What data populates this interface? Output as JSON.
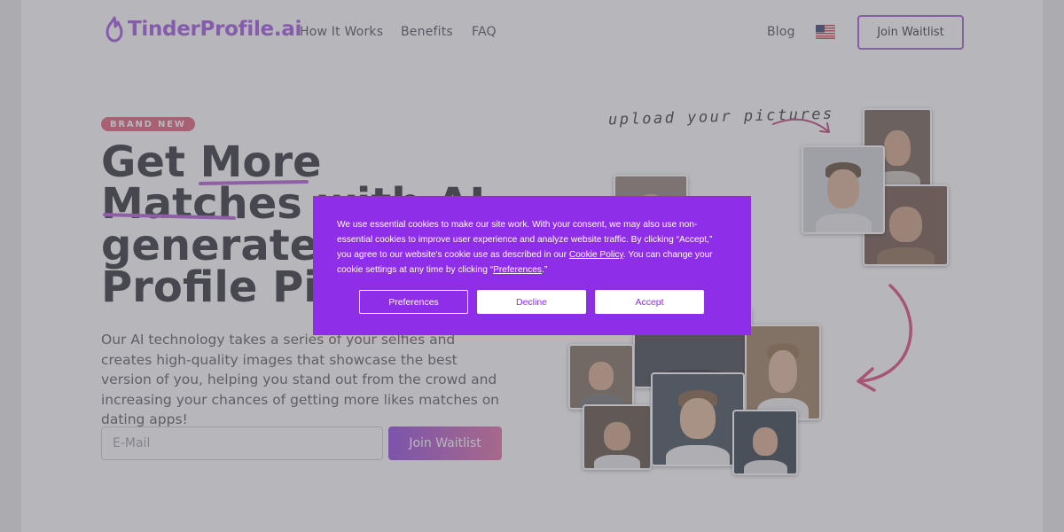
{
  "header": {
    "logo_text": "TinderProfile.ai",
    "nav": {
      "how_it_works": "How It Works",
      "benefits": "Benefits",
      "faq": "FAQ",
      "blog": "Blog"
    },
    "language_flag": "us-flag-icon",
    "join_waitlist": "Join Waitlist"
  },
  "hero": {
    "badge": "BRAND NEW",
    "headline_lines": [
      "Get More",
      "Matches with AI",
      "generated",
      "Profile Pictures"
    ],
    "description": "Our AI technology takes a series of your selfies and creates high-quality images that showcase the best version of you, helping you stand out from the crowd and increasing your chances of getting more likes matches on dating apps!",
    "email_placeholder": "E-Mail",
    "join_waitlist": "Join Waitlist",
    "upload_note": "upload your pictures"
  },
  "cookie_banner": {
    "text_part1": "We use essential cookies to make our site work. With your consent, we may also use non-essential cookies to improve user experience and analyze website traffic. By clicking “Accept,” you agree to our website's cookie use as described in our ",
    "cookie_policy_link": "Cookie Policy",
    "text_part2": ". You can change your cookie settings at any time by clicking “",
    "preferences_link": "Preferences",
    "text_part3": ".”",
    "buttons": {
      "preferences": "Preferences",
      "decline": "Decline",
      "accept": "Accept"
    }
  },
  "colors": {
    "brand_purple": "#a052e0",
    "banner_purple": "#8f2ee8",
    "badge_pink": "#e25a78",
    "arrow_pink": "#e0447a"
  }
}
